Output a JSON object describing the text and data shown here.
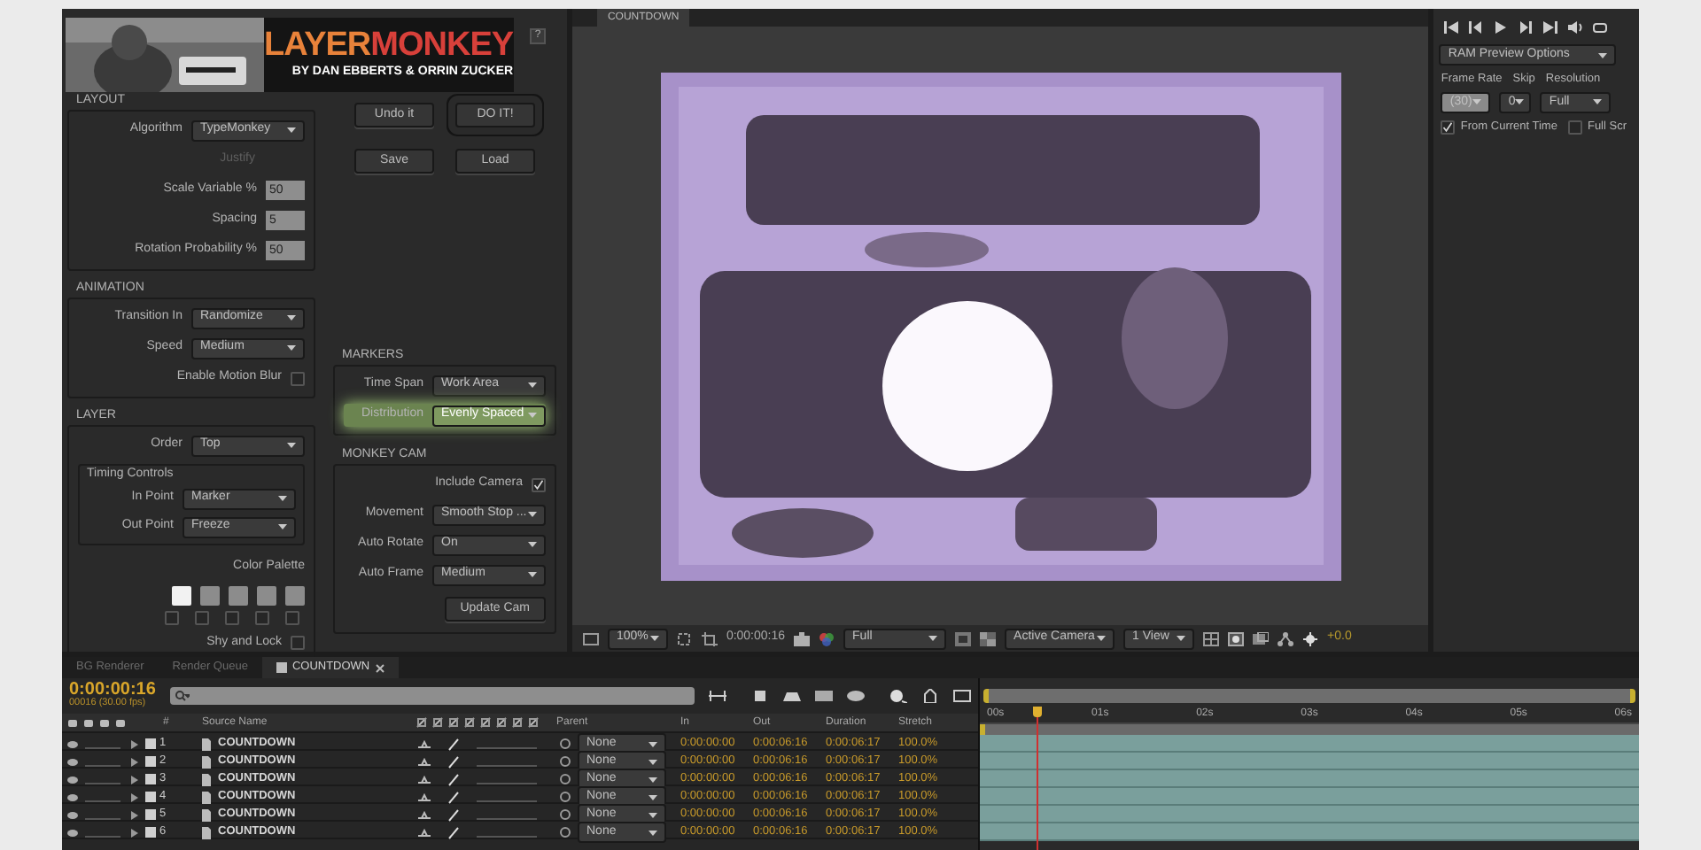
{
  "plugin": {
    "logo": {
      "title_parts": [
        "LAYER",
        "MONKEY"
      ],
      "byline": "BY DAN EBBERTS & ORRIN ZUCKER"
    },
    "help_button": "?",
    "left_sections": [
      {
        "title": "LAYOUT",
        "rows": [
          {
            "kind": "dropdown",
            "label": "Algorithm",
            "value": "TypeMonkey"
          },
          {
            "kind": "note",
            "label": "Justify",
            "disabled": true
          },
          {
            "kind": "number",
            "label": "Scale Variable %",
            "value": "50"
          },
          {
            "kind": "number",
            "label": "Spacing",
            "value": "5"
          },
          {
            "kind": "number",
            "label": "Rotation Probability %",
            "value": "50"
          }
        ]
      },
      {
        "title": "ANIMATION",
        "rows": [
          {
            "kind": "dropdown",
            "label": "Transition In",
            "value": "Randomize"
          },
          {
            "kind": "dropdown",
            "label": "Speed",
            "value": "Medium"
          },
          {
            "kind": "checkbox",
            "label": "Enable Motion Blur",
            "checked": false
          }
        ]
      },
      {
        "title": "LAYER",
        "rows": [
          {
            "kind": "dropdown",
            "label": "Order",
            "value": "Top"
          },
          {
            "kind": "group",
            "title": "Timing Controls",
            "rows": [
              {
                "kind": "dropdown",
                "label": "In Point",
                "value": "Marker"
              },
              {
                "kind": "dropdown",
                "label": "Out Point",
                "value": "Freeze"
              }
            ]
          },
          {
            "kind": "palette",
            "label": "Color Palette",
            "swatches": [
              {
                "color": "#f2f2f2",
                "checked": false
              },
              {
                "color": "#8c8c8c",
                "checked": false
              },
              {
                "color": "#8c8c8c",
                "checked": false
              },
              {
                "color": "#8c8c8c",
                "checked": false
              },
              {
                "color": "#8c8c8c",
                "checked": false
              }
            ]
          },
          {
            "kind": "checkbox",
            "label": "Shy and Lock",
            "checked": false
          }
        ]
      }
    ],
    "buttons": [
      {
        "label": "Undo it",
        "default": false
      },
      {
        "label": "DO IT!",
        "default": true
      },
      {
        "label": "Save",
        "default": false
      },
      {
        "label": "Load",
        "default": false
      }
    ],
    "right_sections": [
      {
        "title": "MARKERS",
        "rows": [
          {
            "kind": "dropdown",
            "label": "Time Span",
            "value": "Work Area",
            "highlighted": false
          },
          {
            "kind": "dropdown",
            "label": "Distribution",
            "value": "Evenly Spaced",
            "highlighted": true
          }
        ]
      },
      {
        "title": "MONKEY CAM",
        "rows": [
          {
            "kind": "checkbox",
            "label": "Include Camera",
            "checked": true
          },
          {
            "kind": "dropdown",
            "label": "Movement",
            "value": "Smooth Stop ...",
            "highlighted": false
          },
          {
            "kind": "dropdown",
            "label": "Auto Rotate",
            "value": "On",
            "highlighted": false
          },
          {
            "kind": "dropdown",
            "label": "Auto Frame",
            "value": "Medium",
            "highlighted": false
          },
          {
            "kind": "button",
            "label": "Update Cam"
          }
        ]
      }
    ]
  },
  "viewer": {
    "tab": "COUNTDOWN",
    "zoom": "100%",
    "timecode": "0:00:00:16",
    "resolution": "Full",
    "view": "Active Camera",
    "layout": "1 View",
    "exposure": "+0.0"
  },
  "preview": {
    "options": "RAM Preview Options",
    "labels": [
      "Frame Rate",
      "Skip",
      "Resolution"
    ],
    "frame_rate": "(30)",
    "skip": "0",
    "resolution": "Full",
    "checks": [
      {
        "label": "From Current Time",
        "checked": true
      },
      {
        "label": "Full Scr",
        "checked": false
      }
    ]
  },
  "timeline": {
    "tabs": [
      {
        "label": "BG Renderer",
        "selected": false
      },
      {
        "label": "Render Queue",
        "selected": false
      },
      {
        "label": "COUNTDOWN",
        "selected": true
      }
    ],
    "timecode": "0:00:00:16",
    "frame_info": "00016 (30.00 fps)",
    "columns": [
      "#",
      "Source Name",
      "Parent",
      "In",
      "Out",
      "Duration",
      "Stretch"
    ],
    "rows": [
      {
        "number": "1",
        "name": "COUNTDOWN",
        "parent": "None",
        "in": "0:00:00:00",
        "out": "0:00:06:16",
        "duration": "0:00:06:17",
        "stretch": "100.0%"
      },
      {
        "number": "2",
        "name": "COUNTDOWN",
        "parent": "None",
        "in": "0:00:00:00",
        "out": "0:00:06:16",
        "duration": "0:00:06:17",
        "stretch": "100.0%"
      },
      {
        "number": "3",
        "name": "COUNTDOWN",
        "parent": "None",
        "in": "0:00:00:00",
        "out": "0:00:06:16",
        "duration": "0:00:06:17",
        "stretch": "100.0%"
      },
      {
        "number": "4",
        "name": "COUNTDOWN",
        "parent": "None",
        "in": "0:00:00:00",
        "out": "0:00:06:16",
        "duration": "0:00:06:17",
        "stretch": "100.0%"
      },
      {
        "number": "5",
        "name": "COUNTDOWN",
        "parent": "None",
        "in": "0:00:00:00",
        "out": "0:00:06:16",
        "duration": "0:00:06:17",
        "stretch": "100.0%"
      },
      {
        "number": "6",
        "name": "COUNTDOWN",
        "parent": "None",
        "in": "0:00:00:00",
        "out": "0:00:06:16",
        "duration": "0:00:06:17",
        "stretch": "100.0%"
      }
    ],
    "ruler": [
      "00s",
      "01s",
      "02s",
      "03s",
      "04s",
      "05s",
      "06s"
    ]
  }
}
